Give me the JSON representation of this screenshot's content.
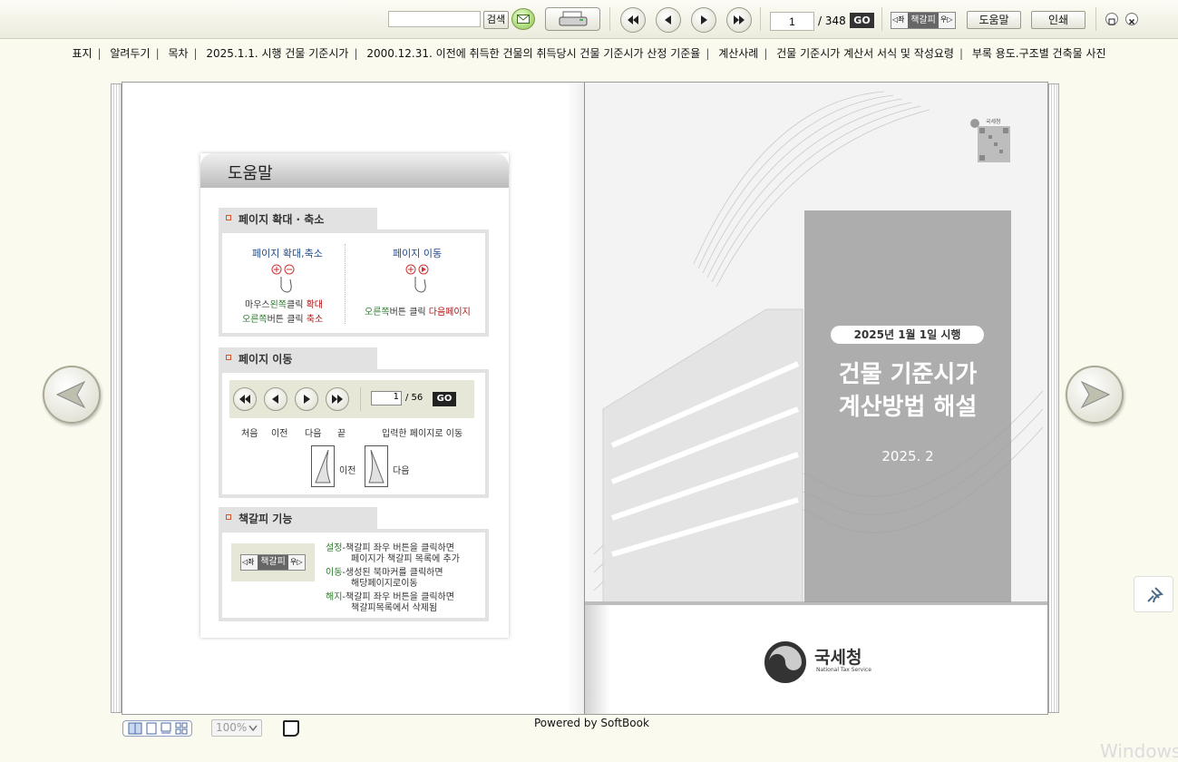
{
  "toolbar": {
    "search_value": "",
    "search_label": "검색",
    "page_current": "1",
    "page_total": "/ 348",
    "go_label": "GO",
    "bookmark_left": "◁좌",
    "bookmark_label": "책갈피",
    "bookmark_right": "우▷",
    "help_label": "도움말",
    "print_label": "인쇄"
  },
  "menu": [
    "표지",
    "알려두기",
    "목차",
    "2025.1.1. 시행 건물 기준시가",
    "2000.12.31. 이전에 취득한 건물의 취득당시 건물 기준시가 산정 기준율",
    "계산사례",
    "건물 기준시가 계산서 서식 및 작성요령",
    "부록 용도.구조별 건축물 사진"
  ],
  "help": {
    "title": "도움말",
    "sec1": {
      "title": "페이지 확대 · 축소",
      "zoom_title": "페이지 확대,축소",
      "zoom_line1_a": "마우스",
      "zoom_line1_b": "왼쪽",
      "zoom_line1_c": "클릭 ",
      "zoom_line1_d": "확대",
      "zoom_line2_a": "오른쪽",
      "zoom_line2_b": "버튼 클릭 ",
      "zoom_line2_c": "축소",
      "move_title": "페이지 이동",
      "move_line_a": "오른쪽",
      "move_line_b": "버튼 클릭 ",
      "move_line_c": "다음페이지"
    },
    "sec2": {
      "title": "페이지 이동",
      "page_value": "1",
      "page_total": "/ 56",
      "go": "GO",
      "labels": [
        "처음",
        "이전",
        "다음",
        "끝"
      ],
      "input_label": "입력한 페이지로 이동",
      "prev": "이전",
      "next": "다음"
    },
    "sec3": {
      "title": "책갈피 기능",
      "bm_left": "◁좌",
      "bm_label": "책갈피",
      "bm_right": "우▷",
      "set_key": "설정",
      "set_text1": "-책갈피 좌우 버튼을 클릭하면",
      "set_text2": "페이지가 책갈피 목록에 추가",
      "move_key": "이동",
      "move_text1": "-생성된 북마커를 클릭하면",
      "move_text2": "해당페이지로이동",
      "del_key": "해지",
      "del_text1": "-책갈피 좌우 버튼을 클릭하면",
      "del_text2": "책갈피목록에서 삭제됨"
    }
  },
  "cover": {
    "stamp": "국세청",
    "date_badge": "2025년 1월 1일 시행",
    "title_line1": "건물 기준시가",
    "title_line2": "계산방법 해설",
    "year": "2025. 2",
    "org_kr": "국세청",
    "org_en": "National Tax Service"
  },
  "footer": {
    "zoom": "100%",
    "powered": "Powered by SoftBook"
  },
  "watermark": "Windows"
}
